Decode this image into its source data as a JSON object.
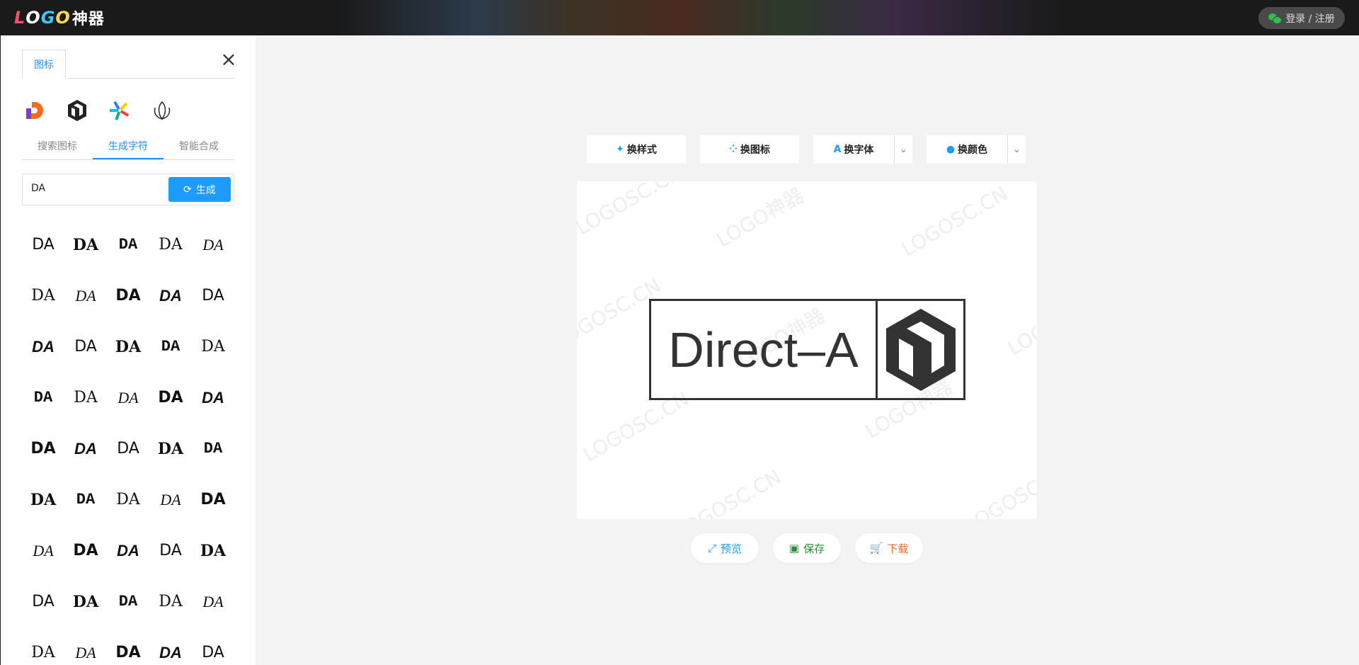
{
  "header": {
    "logo_latin": [
      "L",
      "O",
      "G",
      "O"
    ],
    "logo_cn": "神器",
    "login_label": "登录 / 注册"
  },
  "panel": {
    "tab_label": "图标",
    "subtabs": [
      "搜索图标",
      "生成字符",
      "智能合成"
    ],
    "input_value": "DA",
    "generate_label": "生成",
    "glyph_items": [
      "DA",
      "DA",
      "DA",
      "DA",
      "DA",
      "DA",
      "DA",
      "DA",
      "DA",
      "DA",
      "DA",
      "DA",
      "DA",
      "DA",
      "DA",
      "DA",
      "DA",
      "DA",
      "DA",
      "DA",
      "DA",
      "DA",
      "DA",
      "DA",
      "DA",
      "DA",
      "DA",
      "DA",
      "DA",
      "DA",
      "DA",
      "DA",
      "DA",
      "DA",
      "DA",
      "DA",
      "DA",
      "DA",
      "DA",
      "DA",
      "DA",
      "DA",
      "DA",
      "DA",
      "DA"
    ]
  },
  "toolbar": {
    "style_label": "换样式",
    "icon_label": "换图标",
    "font_label": "换字体",
    "color_label": "换颜色"
  },
  "canvas": {
    "logo_text": "Direct–A",
    "watermark": "LOGOSC.CN",
    "watermark_cn": "LOGO神器"
  },
  "actions": {
    "preview_label": "预览",
    "save_label": "保存",
    "download_label": "下载"
  },
  "colors": {
    "accent": "#1e9bff",
    "save": "#2e8b3a",
    "download": "#ff6a2a"
  }
}
